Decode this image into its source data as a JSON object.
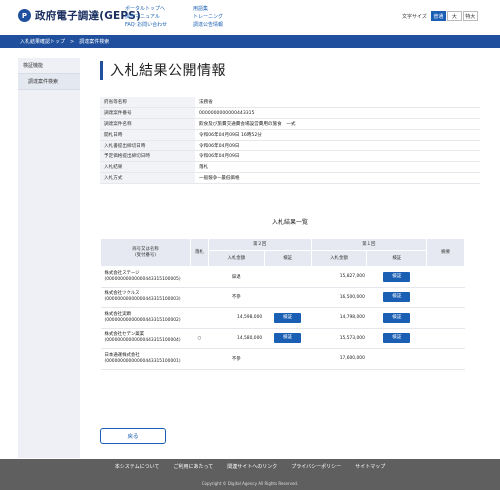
{
  "header": {
    "logo_mark": "P",
    "logo_text": "政府電子調達(GEPS)",
    "links_col1": [
      "ポータルトップへ",
      "操作マニュアル",
      "FAQ･お問い合わせ"
    ],
    "links_col2": [
      "用語集",
      "トレーニング",
      "調達公告情報"
    ],
    "font_size_label": "文字サイズ",
    "font_sizes": [
      "普通",
      "大",
      "特大"
    ],
    "font_size_active": "普通"
  },
  "breadcrumb": [
    "入札結果確認トップ",
    "調達案件検索"
  ],
  "sidebar": {
    "items": [
      {
        "label": "検証機能"
      },
      {
        "label": "調達案件検索"
      }
    ]
  },
  "page_title": "入札結果公開情報",
  "info_rows": [
    {
      "key": "府省等名称",
      "value": "法務省"
    },
    {
      "key": "調達案件番号",
      "value": "0000000000000443315"
    },
    {
      "key": "調達案件名称",
      "value": "飲食及び旅費交通費会場設営費用の施食　一式"
    },
    {
      "key": "開札日時",
      "value": "令和06年04月09日 16時52分"
    },
    {
      "key": "入札書提出締切日時",
      "value": "令和06年04月09日"
    },
    {
      "key": "予定価格提出締切日時",
      "value": "令和06年04月09日"
    },
    {
      "key": "入札結果",
      "value": "落札"
    },
    {
      "key": "入札方式",
      "value": "一般競争−最低価格"
    }
  ],
  "results": {
    "title": "入札結果一覧",
    "headers": {
      "company": "商号又は名称",
      "company_sub": "(受付番号)",
      "award": "落札",
      "round2": "第２回",
      "round1": "第１回",
      "amount": "入札金額",
      "verify": "検証",
      "remarks": "摘要"
    },
    "rows": [
      {
        "name": "株式会社ステージ",
        "number": "(00000000000000443315100005)",
        "award": "",
        "r2_amount": "",
        "r2_status": "辞退",
        "r2_verify": "",
        "r1_amount": "15,827,000",
        "r1_verify": "検証",
        "remarks": ""
      },
      {
        "name": "株式会社ツクルス",
        "number": "(00000000000000443315100003)",
        "award": "",
        "r2_amount": "",
        "r2_status": "不参",
        "r2_verify": "",
        "r1_amount": "16,500,000",
        "r1_verify": "検証",
        "remarks": ""
      },
      {
        "name": "株式会社実顕",
        "number": "(00000000000000443315100002)",
        "award": "",
        "r2_amount": "14,598,000",
        "r2_status": "",
        "r2_verify": "検証",
        "r1_amount": "14,798,000",
        "r1_verify": "検証",
        "remarks": ""
      },
      {
        "name": "株式会社セデン薬業",
        "number": "(00000000000000443315100004)",
        "award": "○",
        "r2_amount": "14,580,000",
        "r2_status": "",
        "r2_verify": "検証",
        "r1_amount": "15,573,000",
        "r1_verify": "検証",
        "remarks": ""
      },
      {
        "name": "日本通運株式会社",
        "number": "(00000000000000443315100001)",
        "award": "",
        "r2_amount": "",
        "r2_status": "不参",
        "r2_verify": "",
        "r1_amount": "17,600,000",
        "r1_verify": "",
        "remarks": ""
      }
    ]
  },
  "back_label": "戻る",
  "footer": {
    "links": [
      "本システムについて",
      "ご利用にあたって",
      "関連サイトへのリンク",
      "プライバシーポリシー",
      "サイトマップ"
    ],
    "copyright": "Copyright © Digital Agency All Rights Reserved."
  },
  "colors": {
    "brand": "#1f4f9d",
    "button": "#1a5fb4",
    "footer": "#5f5f5f"
  }
}
